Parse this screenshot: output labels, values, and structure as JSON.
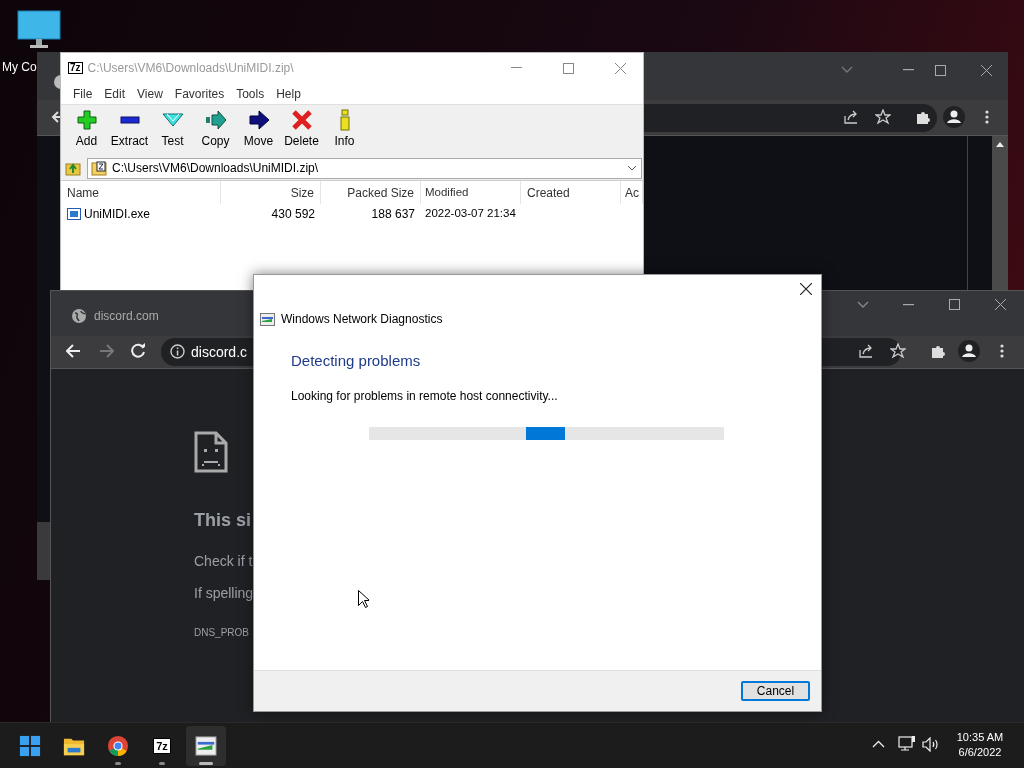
{
  "desktop": {
    "icons": [
      {
        "label": "My Co"
      }
    ]
  },
  "archive_window": {
    "icon_label": "7z",
    "title": "C:\\Users\\VM6\\Downloads\\UniMIDI.zip\\",
    "menu": [
      "File",
      "Edit",
      "View",
      "Favorites",
      "Tools",
      "Help"
    ],
    "toolbar": [
      {
        "kind": "add",
        "label": "Add"
      },
      {
        "kind": "extract",
        "label": "Extract"
      },
      {
        "kind": "test",
        "label": "Test"
      },
      {
        "kind": "copy",
        "label": "Copy"
      },
      {
        "kind": "move",
        "label": "Move"
      },
      {
        "kind": "delete",
        "label": "Delete"
      },
      {
        "kind": "info",
        "label": "Info"
      }
    ],
    "address": "C:\\Users\\VM6\\Downloads\\UniMIDI.zip\\",
    "columns": [
      "Name",
      "Size",
      "Packed Size",
      "Modified",
      "Created",
      "Ac"
    ],
    "rows": [
      {
        "cells": [
          "UniMIDI.exe",
          "430 592",
          "188 637",
          "2022-03-07 21:34"
        ]
      }
    ]
  },
  "browser": {
    "tab_title": "discord.com",
    "address": "discord.c",
    "error": {
      "heading": "This si",
      "lines": [
        "Check if t",
        "If spelling"
      ],
      "code": "DNS_PROB"
    }
  },
  "dialog": {
    "title": "Windows Network Diagnostics",
    "heading": "Detecting problems",
    "status": "Looking for problems in remote host connectivity...",
    "progress": {
      "indeterminate": true
    },
    "button": "Cancel"
  },
  "taskbar": {
    "apps": [
      {
        "kind": "start",
        "selected": false,
        "running": false
      },
      {
        "kind": "explorer",
        "selected": false,
        "running": false
      },
      {
        "kind": "chrome",
        "selected": false,
        "running": true
      },
      {
        "kind": "sevenzip",
        "label": "7z",
        "selected": false,
        "running": true
      },
      {
        "kind": "diagnostics",
        "selected": true,
        "running": true
      }
    ],
    "clock": {
      "time": "10:35 AM",
      "date": "6/6/2022"
    }
  }
}
